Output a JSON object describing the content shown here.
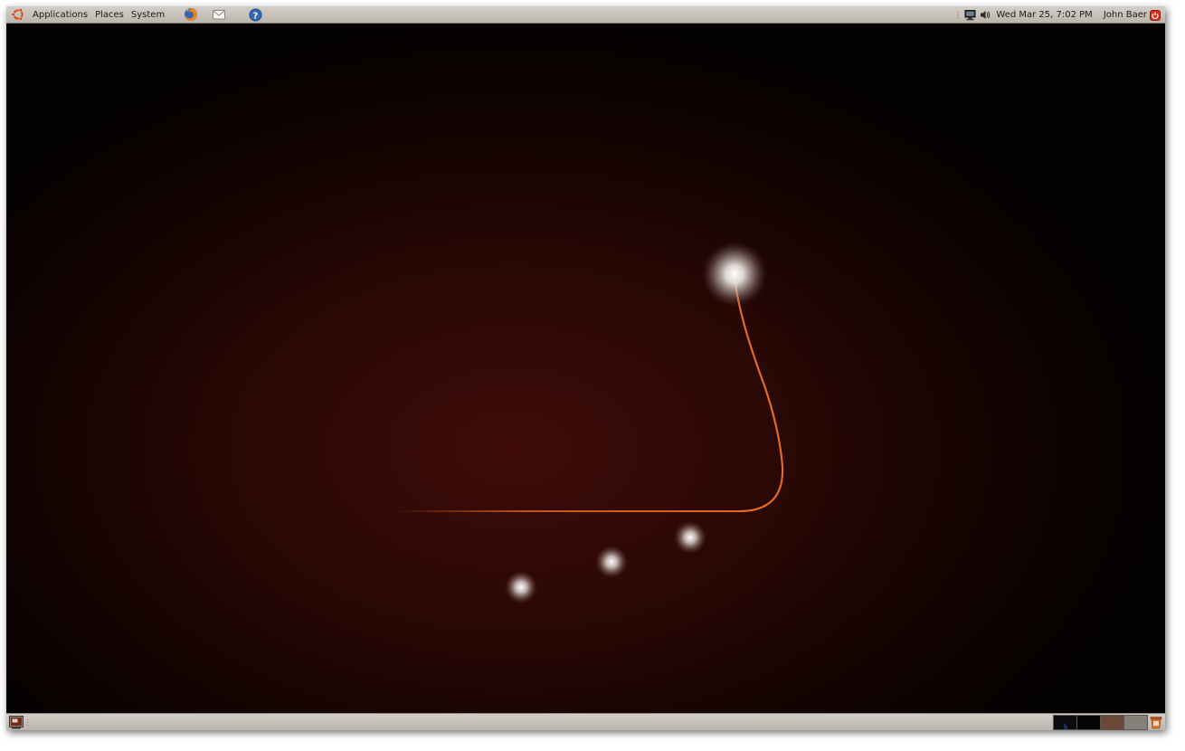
{
  "top_panel": {
    "menus": [
      {
        "label": "Applications"
      },
      {
        "label": "Places"
      },
      {
        "label": "System"
      }
    ],
    "launchers": [
      {
        "icon": "firefox-icon"
      },
      {
        "icon": "mail-icon"
      },
      {
        "icon": "help-icon"
      }
    ],
    "tray": {
      "icons": [
        "network-icon",
        "volume-icon"
      ],
      "clock": "Wed Mar 25,  7:02 PM",
      "user": "John Baer"
    }
  },
  "bottom_panel": {
    "workspaces": [
      {
        "color": "#0c0c10"
      },
      {
        "color": "#050505"
      },
      {
        "color": "#6a4a36"
      },
      {
        "color": "#858079"
      }
    ]
  },
  "colors": {
    "panel": "#c9c4bc",
    "accent": "#e95420",
    "streak": "#e0621c",
    "ubuntu_logo": "#dd4814"
  }
}
